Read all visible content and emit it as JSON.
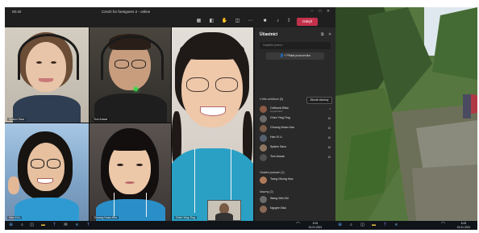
{
  "window": {
    "clock": "00:40",
    "title": "Czech for foreigners 2 - online",
    "leave_label": "Odejít"
  },
  "participants_panel": {
    "title": "Účastníci",
    "search_placeholder": "Najděte jméno",
    "add_label": "Přidat pracovníka",
    "mute_all_label": "Ztlumit všechny",
    "in_meeting_header": "V této schůzce (5)",
    "invited_header": "Ostatní pozvaní (1)",
    "others_header": "Navrhy (2)",
    "members": [
      {
        "name": "Cvitková Elika",
        "role": "Organizátor",
        "color": "#8a5a44"
      },
      {
        "name": "Chen Ying-Ting",
        "role": "",
        "color": "#6b6b6b"
      },
      {
        "name": "Chuong Hoan-Hue",
        "role": "",
        "color": "#7a5d4a"
      },
      {
        "name": "Han Xi Li",
        "role": "",
        "color": "#555f6e"
      },
      {
        "name": "Spalov Sara",
        "role": "",
        "color": "#8c7560"
      },
      {
        "name": "Tom Anwar",
        "role": "",
        "color": "#4f4f4f"
      }
    ],
    "invited": [
      {
        "name": "Trang Nhung Hua",
        "role": "",
        "color": "#b07a5a"
      }
    ],
    "others": [
      {
        "name": "Wang Wei-Chi",
        "role": "",
        "color": "#6a6a6a"
      },
      {
        "name": "Nguyen Bảo",
        "role": "",
        "color": "#8b6a55"
      }
    ]
  },
  "video_tiles": [
    {
      "name": "Spalov Sara"
    },
    {
      "name": "Tom Anwar"
    },
    {
      "name": "Han Xi Li"
    },
    {
      "name": "Chuong Hoan-Hue"
    },
    {
      "name": "Chen Ying-Ting"
    }
  ],
  "taskbar": {
    "time": "8:15",
    "date": "01.01.2021"
  },
  "icons": {
    "video_icon": "video-camera",
    "mic_icon": "microphone",
    "share_icon": "share-screen",
    "more_icon": "more-dots",
    "participants_icon": "people",
    "chat_icon": "chat-bubble",
    "raise_hand_icon": "hand"
  },
  "colors": {
    "leave_button": "#c4314b",
    "active_icon": "#9ea2ff",
    "panel_bg": "#292929"
  }
}
